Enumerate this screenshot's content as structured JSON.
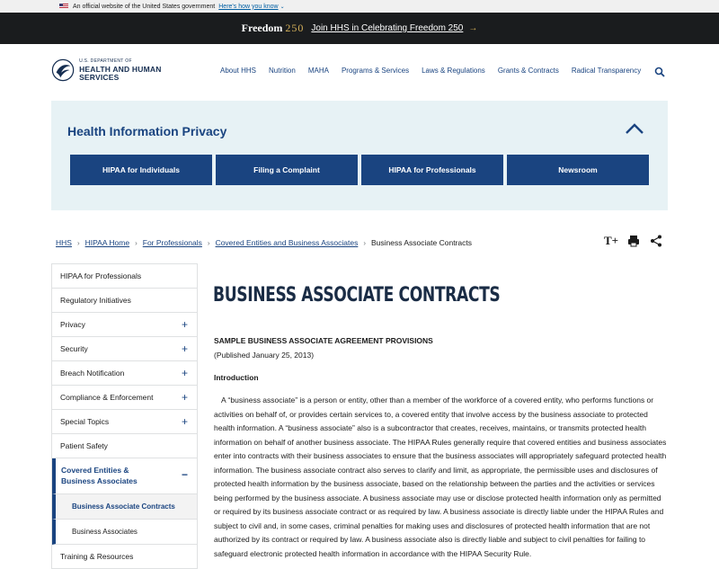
{
  "gov_banner": {
    "text": "An official website of the United States government",
    "link": "Here's how you know"
  },
  "freedom_bar": {
    "logo_word": "Freedom",
    "logo_num": "250",
    "link": "Join HHS in Celebrating Freedom 250"
  },
  "header": {
    "logo_small": "U.S. DEPARTMENT OF",
    "logo_big": "HEALTH AND HUMAN SERVICES",
    "nav": [
      "About HHS",
      "Nutrition",
      "MAHA",
      "Programs & Services",
      "Laws & Regulations",
      "Grants & Contracts",
      "Radical Transparency"
    ]
  },
  "hip": {
    "title": "Health Information Privacy",
    "buttons": [
      "HIPAA for Individuals",
      "Filing a Complaint",
      "HIPAA for Professionals",
      "Newsroom"
    ]
  },
  "breadcrumb": {
    "links": [
      "HHS",
      "HIPAA Home",
      "For Professionals",
      "Covered Entities and Business Associates"
    ],
    "current": "Business Associate Contracts",
    "text_size_label": "T+"
  },
  "sidenav": {
    "items": [
      {
        "label": "HIPAA for Professionals",
        "expandable": false
      },
      {
        "label": "Regulatory Initiatives",
        "expandable": false
      },
      {
        "label": "Privacy",
        "expandable": true
      },
      {
        "label": "Security",
        "expandable": true
      },
      {
        "label": "Breach Notification",
        "expandable": true
      },
      {
        "label": "Compliance & Enforcement",
        "expandable": true
      },
      {
        "label": "Special Topics",
        "expandable": true
      },
      {
        "label": "Patient Safety",
        "expandable": false
      }
    ],
    "current": {
      "label_line1": "Covered Entities &",
      "label_line2": "Business Associates",
      "toggle": "−"
    },
    "subitems": [
      "Business Associate Contracts",
      "Business Associates"
    ],
    "after": [
      {
        "label": "Training & Resources"
      }
    ]
  },
  "content": {
    "title": "BUSINESS ASSOCIATE CONTRACTS",
    "doc_heading": "SAMPLE BUSINESS ASSOCIATE AGREEMENT PROVISIONS",
    "published": "(Published January 25, 2013)",
    "intro_heading": "Introduction",
    "body": "A “business associate” is a person or entity, other than a member of the workforce of a covered entity, who performs functions or activities on behalf of, or provides certain services to, a covered entity that involve access by the business associate to protected health information.  A “business associate” also is a subcontractor that creates, receives, maintains, or transmits protected health information on behalf of another business associate.  The HIPAA Rules generally require that covered entities and business associates enter into contracts with their business associates to ensure that the business associates will appropriately safeguard protected health information.  The business associate contract also serves to clarify and limit, as appropriate, the permissible uses and disclosures of protected health information by the business associate, based on the relationship between the parties and the activities or services being performed by the business associate.  A business associate may use or disclose protected health information only as permitted or required by its business associate contract or as required by law.  A business associate is directly liable under the HIPAA Rules and subject to civil and, in some cases, criminal penalties for making uses and disclosures of protected health information that are not authorized by its contract or required by law. A business associate also is directly liable and subject to civil penalties for failing to safeguard electronic protected health information in accordance with the HIPAA Security Rule."
  },
  "colors": {
    "primary": "#1a4480",
    "dark_bar": "#1a1c1e",
    "accent_gold": "#d4b05a",
    "panel_bg": "#e7f2f5"
  }
}
